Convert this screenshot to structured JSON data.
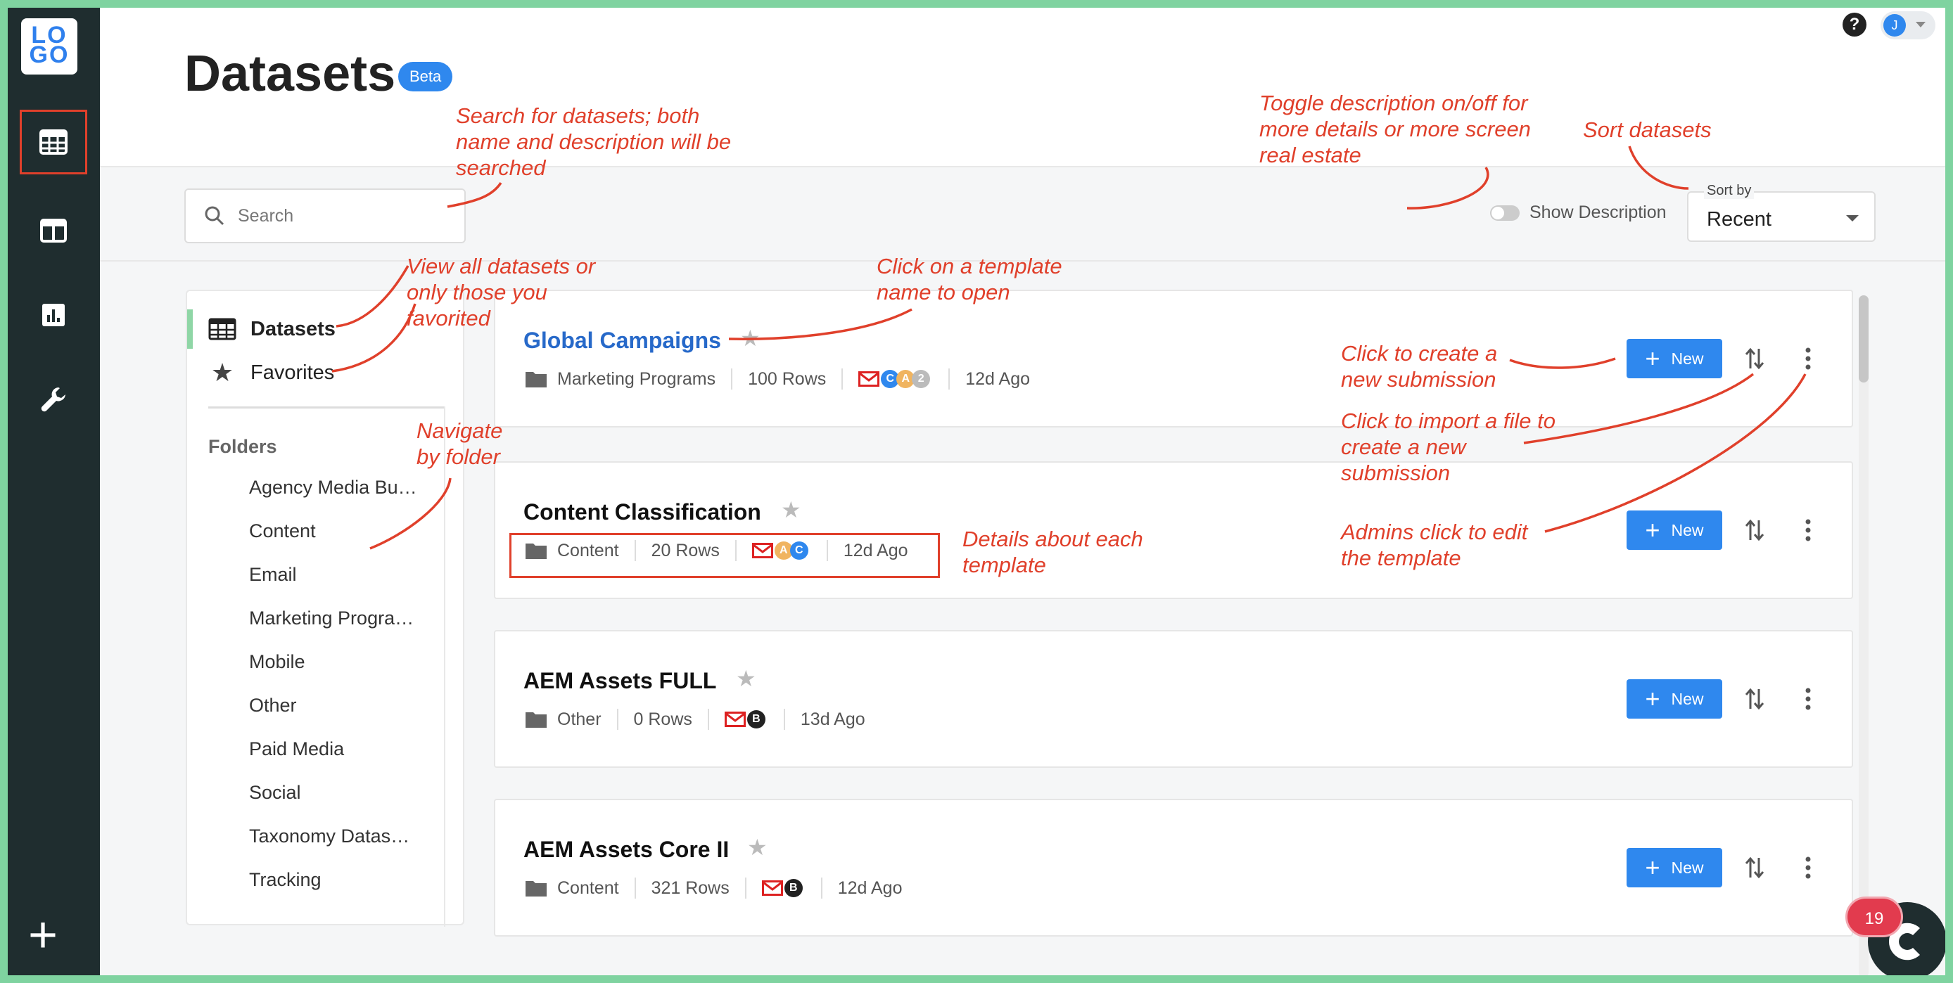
{
  "logo": "LOGO",
  "page": {
    "title": "Datasets",
    "badge": "Beta"
  },
  "user": {
    "initial": "J"
  },
  "toolbar": {
    "search_placeholder": "Search",
    "toggle_label": "Show Description",
    "sort_label": "Sort by",
    "sort_value": "Recent"
  },
  "sidebar": {
    "nav": [
      {
        "label": "Datasets",
        "icon": "table-icon",
        "active": true
      },
      {
        "label": "Favorites",
        "icon": "star-icon",
        "active": false
      }
    ],
    "folders_title": "Folders",
    "folders": [
      "Agency Media Bu…",
      "Content",
      "Email",
      "Marketing Progra…",
      "Mobile",
      "Other",
      "Paid Media",
      "Social",
      "Taxonomy Datas…",
      "Tracking"
    ]
  },
  "datasets": [
    {
      "name": "Global Campaigns",
      "folder": "Marketing Programs",
      "rows": "100 Rows",
      "updated": "12d Ago",
      "extra_count": "2",
      "new_label": "New"
    },
    {
      "name": "Content Classification",
      "folder": "Content",
      "rows": "20 Rows",
      "updated": "12d Ago",
      "new_label": "New"
    },
    {
      "name": "AEM Assets FULL",
      "folder": "Other",
      "rows": "0 Rows",
      "updated": "13d Ago",
      "new_label": "New"
    },
    {
      "name": "AEM Assets Core II",
      "folder": "Content",
      "rows": "321 Rows",
      "updated": "12d Ago",
      "new_label": "New"
    }
  ],
  "chat": {
    "badge": "19"
  },
  "annotations": {
    "search": "Search for datasets; both name and description will be searched",
    "toggle": "Toggle description on/off for more details or more screen real estate",
    "sort": "Sort datasets",
    "view": "View all datasets or only those you favorited",
    "template": "Click on a template name to open",
    "create": "Click to create a new submission",
    "import": "Click to import a file to create a new submission",
    "folder": "Navigate by folder",
    "details": "Details about each template",
    "admin": "Admins click to edit the template"
  },
  "colors": {
    "accent": "#2f88ee",
    "annotation": "#e0402b",
    "rail": "#1f2d2f",
    "frame": "#7fd3a0",
    "badge": "#e23b4e"
  }
}
